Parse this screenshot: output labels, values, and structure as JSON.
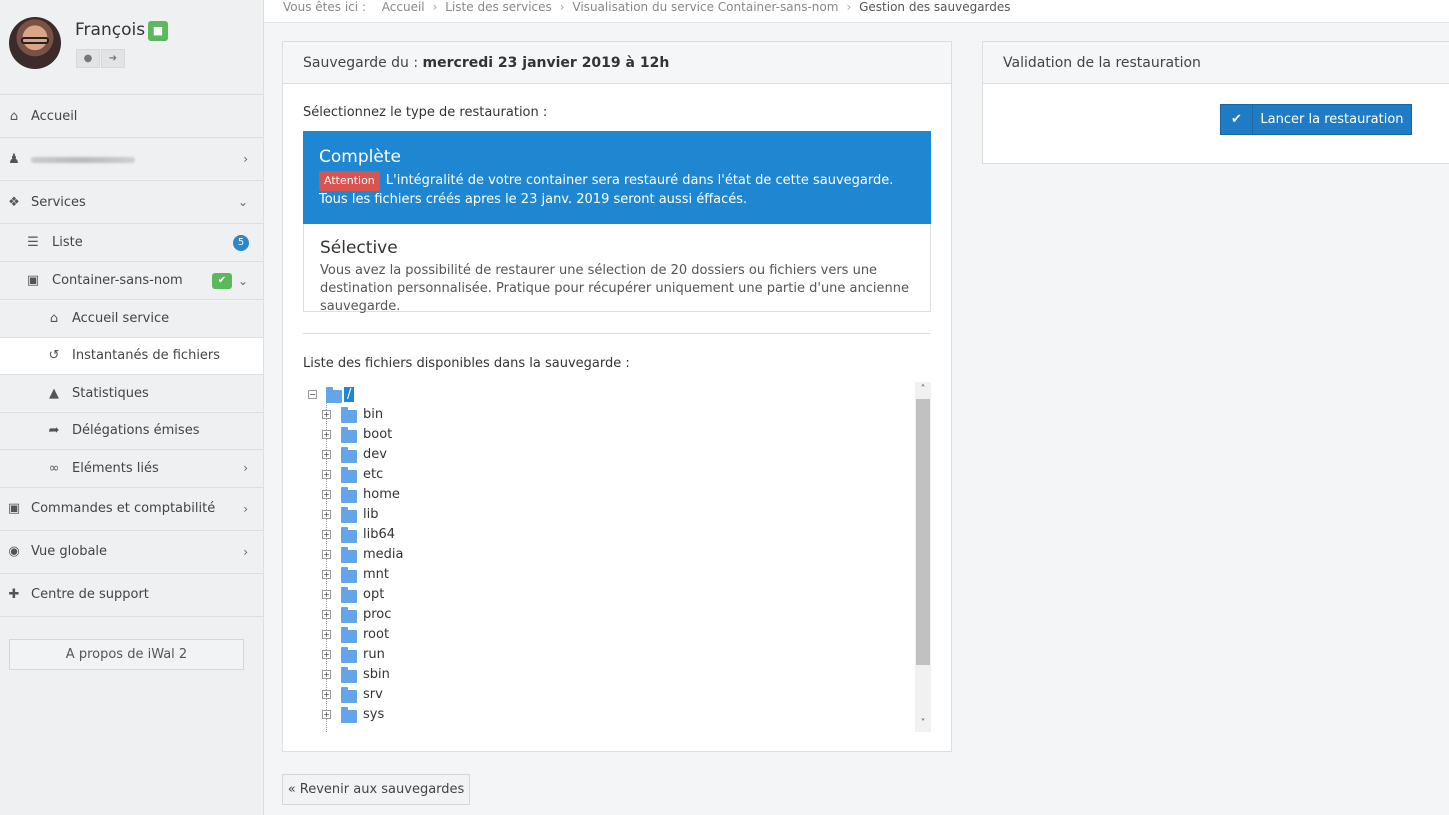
{
  "user": {
    "name": "François"
  },
  "sidebar": {
    "items": [
      {
        "icon": "home-icon",
        "label": "Accueil"
      },
      {
        "icon": "person-icon",
        "label": ""
      },
      {
        "icon": "cubes-icon",
        "label": "Services"
      },
      {
        "icon": "list-icon",
        "label": "Liste",
        "badge": "5"
      },
      {
        "icon": "container-icon",
        "label": "Container-sans-nom"
      },
      {
        "icon": "home-icon",
        "label": "Accueil service"
      },
      {
        "icon": "history-icon",
        "label": "Instantanés de fichiers"
      },
      {
        "icon": "area-chart-icon",
        "label": "Statistiques"
      },
      {
        "icon": "share-icon",
        "label": "Délégations émises"
      },
      {
        "icon": "link-icon",
        "label": "Eléments liés"
      },
      {
        "icon": "cart-icon",
        "label": "Commandes et comptabilité"
      },
      {
        "icon": "binoculars-icon",
        "label": "Vue globale"
      },
      {
        "icon": "medkit-icon",
        "label": "Centre de support"
      }
    ],
    "about": "A propos de iWal 2"
  },
  "breadcrumb": {
    "prefix": "Vous êtes ici :",
    "items": [
      "Accueil",
      "Liste des services",
      "Visualisation du service Container-sans-nom"
    ],
    "current": "Gestion des sauvegardes"
  },
  "backup": {
    "title_prefix": "Sauvegarde du :",
    "title_date": "mercredi 23 janvier 2019 à 12h",
    "select_label": "Sélectionnez le type de restauration :",
    "complete": {
      "title": "Complète",
      "badge": "Attention",
      "text": "L'intégralité de votre container sera restauré dans l'état de cette sauvegarde. Tous les fichiers créés apres le 23 janv. 2019 seront aussi éffacés."
    },
    "selective": {
      "title": "Sélective",
      "text": "Vous avez la possibilité de restaurer une sélection de 20 dossiers ou fichiers vers une destination personnalisée. Pratique pour récupérer uniquement une partie d'une ancienne sauvegarde."
    },
    "files_label": "Liste des fichiers disponibles dans la sauvegarde :",
    "root": "/",
    "folders": [
      "bin",
      "boot",
      "dev",
      "etc",
      "home",
      "lib",
      "lib64",
      "media",
      "mnt",
      "opt",
      "proc",
      "root",
      "run",
      "sbin",
      "srv",
      "sys"
    ]
  },
  "validation": {
    "title": "Validation de la restauration",
    "button": "Lancer la restauration"
  },
  "back_button": "« Revenir aux sauvegardes"
}
